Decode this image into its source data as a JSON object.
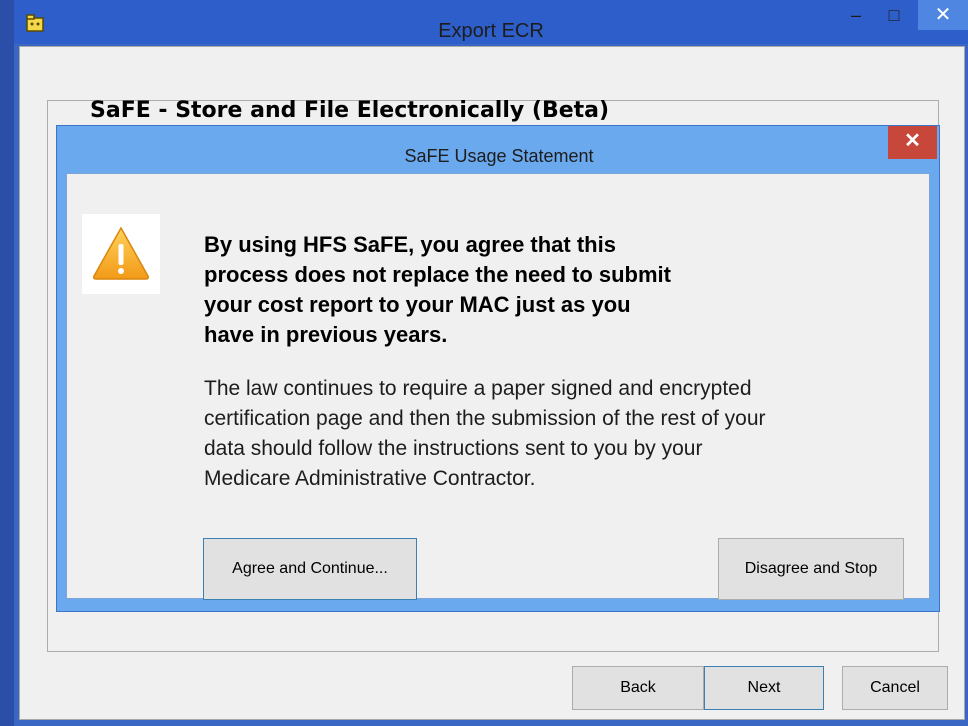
{
  "window": {
    "title": "Export ECR",
    "minimize_glyph": "–",
    "maximize_glyph": "□",
    "close_glyph": "✕",
    "icon": "app-folder-icon",
    "accent_color": "#2e5ec9"
  },
  "group": {
    "header": "SaFE - Store and File Electronically (Beta)"
  },
  "dialog": {
    "title": "SaFE Usage Statement",
    "close_glyph": "✕",
    "icon": "warning-icon",
    "heading_lines": [
      "By using HFS SaFE, you agree that this",
      "process does not replace the need to submit",
      "your cost report to your MAC just as you",
      "have in previous years."
    ],
    "body_lines": [
      "The law continues to require a paper signed and encrypted",
      "certification page and then the submission of the rest of your",
      "data should follow the instructions sent to you by your",
      "Medicare Administrative Contractor."
    ],
    "agree_label": "Agree and Continue...",
    "disagree_label": "Disagree and Stop"
  },
  "footer": {
    "back_label": "Back",
    "next_label": "Next",
    "cancel_label": "Cancel"
  }
}
